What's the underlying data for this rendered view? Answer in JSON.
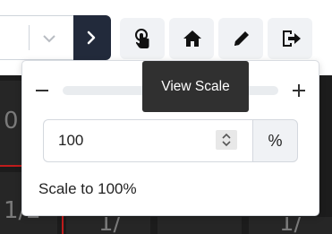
{
  "toolbar": {
    "select_value": "",
    "buttons": [
      {
        "name": "view-scale",
        "icon": "pointer-hand-icon"
      },
      {
        "name": "home",
        "icon": "home-icon"
      },
      {
        "name": "edit",
        "icon": "pencil-icon"
      },
      {
        "name": "exit",
        "icon": "sign-out-icon"
      }
    ]
  },
  "tooltip": {
    "text": "View Scale"
  },
  "scale_popover": {
    "slider_level_percent": 100,
    "zoom_value": "100",
    "unit": "%",
    "scale_link": "Scale to 100%"
  },
  "background_canvas": {
    "labels": [
      "0",
      "1/2",
      "1/",
      "1/"
    ]
  },
  "colors": {
    "dark_button": "#222a3b",
    "slider_thumb": "#8a1520",
    "tooltip_bg": "#303030",
    "accent_red": "#c01c1c"
  }
}
